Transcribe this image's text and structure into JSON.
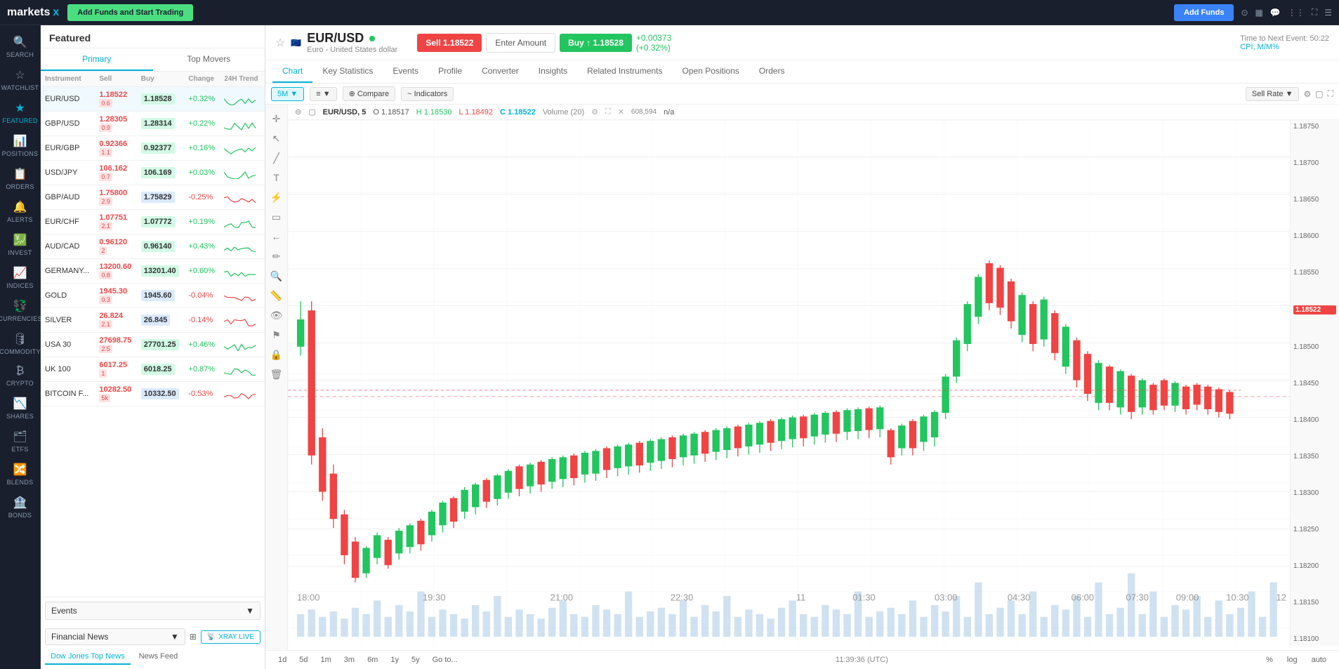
{
  "topNav": {
    "logo": "markets",
    "logoX": "x",
    "addFundsStart": "Add Funds and Start Trading",
    "addFunds": "Add Funds",
    "icons": [
      "layout",
      "chat",
      "grid",
      "expand",
      "menu"
    ]
  },
  "sidebar": {
    "items": [
      {
        "label": "Search",
        "icon": "🔍",
        "id": "search"
      },
      {
        "label": "Watchlist",
        "icon": "☆",
        "id": "watchlist"
      },
      {
        "label": "Featured",
        "icon": "★",
        "id": "featured"
      },
      {
        "label": "Positions",
        "icon": "📊",
        "id": "positions"
      },
      {
        "label": "Orders",
        "icon": "📋",
        "id": "orders"
      },
      {
        "label": "Alerts",
        "icon": "🔔",
        "id": "alerts"
      },
      {
        "label": "Invest",
        "icon": "💹",
        "id": "invest"
      },
      {
        "label": "Indices",
        "icon": "📈",
        "id": "indices"
      },
      {
        "label": "Currencies",
        "icon": "💱",
        "id": "currencies"
      },
      {
        "label": "Commodity",
        "icon": "🛢",
        "id": "commodity"
      },
      {
        "label": "Crypto",
        "icon": "₿",
        "id": "crypto"
      },
      {
        "label": "Shares",
        "icon": "📉",
        "id": "shares"
      },
      {
        "label": "ETFs",
        "icon": "🗂",
        "id": "etfs"
      },
      {
        "label": "Blends",
        "icon": "🔀",
        "id": "blends"
      },
      {
        "label": "Bonds",
        "icon": "🏦",
        "id": "bonds"
      }
    ]
  },
  "featuredPanel": {
    "title": "Featured",
    "tabs": [
      "Primary",
      "Top Movers"
    ],
    "activeTab": 0,
    "tableHeaders": [
      "Instrument",
      "Sell",
      "Buy",
      "Change",
      "24H Trend"
    ],
    "instruments": [
      {
        "name": "EUR/USD",
        "sell": "1.18522",
        "spread": "0.6",
        "buy": "1.18528",
        "change": "+0.32%",
        "positive": true
      },
      {
        "name": "GBP/USD",
        "sell": "1.28305",
        "spread": "0.9",
        "buy": "1.28314",
        "change": "+0.22%",
        "positive": true
      },
      {
        "name": "EUR/GBP",
        "sell": "0.92366",
        "spread": "1.1",
        "buy": "0.92377",
        "change": "+0.16%",
        "positive": true
      },
      {
        "name": "USD/JPY",
        "sell": "106.162",
        "spread": "0.7",
        "buy": "106.169",
        "change": "+0.03%",
        "positive": true
      },
      {
        "name": "GBP/AUD",
        "sell": "1.75800",
        "spread": "2.9",
        "buy": "1.75829",
        "change": "-0.25%",
        "positive": false
      },
      {
        "name": "EUR/CHF",
        "sell": "1.07751",
        "spread": "2.1",
        "buy": "1.07772",
        "change": "+0.19%",
        "positive": true
      },
      {
        "name": "AUD/CAD",
        "sell": "0.96120",
        "spread": "2",
        "buy": "0.96140",
        "change": "+0.43%",
        "positive": true
      },
      {
        "name": "GERMANY...",
        "sell": "13200.60",
        "spread": "0.8",
        "buy": "13201.40",
        "change": "+0.60%",
        "positive": true
      },
      {
        "name": "GOLD",
        "sell": "1945.30",
        "spread": "0.3",
        "buy": "1945.60",
        "change": "-0.04%",
        "positive": false
      },
      {
        "name": "SILVER",
        "sell": "26.824",
        "spread": "2.1",
        "buy": "26.845",
        "change": "-0.14%",
        "positive": false
      },
      {
        "name": "USA 30",
        "sell": "27698.75",
        "spread": "2.5",
        "buy": "27701.25",
        "change": "+0.46%",
        "positive": true
      },
      {
        "name": "UK 100",
        "sell": "6017.25",
        "spread": "1",
        "buy": "6018.25",
        "change": "+0.87%",
        "positive": true
      },
      {
        "name": "BITCOIN F...",
        "sell": "10282.50",
        "spread": "5k",
        "buy": "10332.50",
        "change": "-0.53%",
        "positive": false
      }
    ]
  },
  "eventsSection": {
    "label": "Events",
    "arrow": "▼"
  },
  "newsSection": {
    "label": "Financial News",
    "arrow": "▼",
    "xrayLabel": "XRAY LIVE",
    "tabs": [
      "Dow Jones Top News",
      "News Feed"
    ],
    "activeTab": 0
  },
  "chartHeader": {
    "instrument": "EUR/USD",
    "dotIndicator": "●",
    "fullName": "Euro - United States dollar",
    "sellLabel": "Sell",
    "sellPrice": "1.18522",
    "enterAmount": "Enter Amount",
    "buyLabel": "Buy ↑",
    "buyPrice": "1.18528",
    "priceChange": "+0.00373",
    "pctChange": "(+0.32%)",
    "timerLabel": "Time to Next Event: 50:22",
    "cpiLabel": "CPI, M/M%"
  },
  "chartTabs": {
    "items": [
      "Chart",
      "Key Statistics",
      "Events",
      "Profile",
      "Converter",
      "Insights",
      "Related Instruments",
      "Open Positions",
      "Orders"
    ],
    "active": 0
  },
  "chartToolbar": {
    "timeframe": "5M",
    "candleIcon": "≡",
    "compareLabel": "Compare",
    "indicatorsLabel": "Indicators",
    "sellRateLabel": "Sell Rate",
    "settingsIcon": "⚙",
    "expandIcon": "⛶"
  },
  "ohlc": {
    "instrument": "EUR/USD, 5",
    "o": "O 1.18517",
    "h": "H 1.18530",
    "l": "L 1.18492",
    "c": "C 1.18522",
    "volume": "Volume (20)",
    "volumeValue": "n/a"
  },
  "timeAxis": {
    "labels": [
      "18:00",
      "19:30",
      "21:00",
      "22:30",
      "11",
      "01:30",
      "03:00",
      "04:30",
      "06:00",
      "07:30",
      "09:00",
      "10:30",
      "12"
    ]
  },
  "priceAxis": {
    "labels": [
      "1.18750",
      "1.18700",
      "1.18650",
      "1.18600",
      "1.18550",
      "1.18500",
      "1.18450",
      "1.18400",
      "1.18350",
      "1.18300",
      "1.18250",
      "1.18200",
      "1.18150",
      "1.18100"
    ]
  },
  "timeframes": {
    "buttons": [
      "1d",
      "5d",
      "1m",
      "3m",
      "6m",
      "1y",
      "5y",
      "Go to..."
    ],
    "active": "5m"
  },
  "bottomBar": {
    "time": "11:39:36 (UTC)",
    "options": [
      "%",
      "log",
      "auto"
    ]
  }
}
